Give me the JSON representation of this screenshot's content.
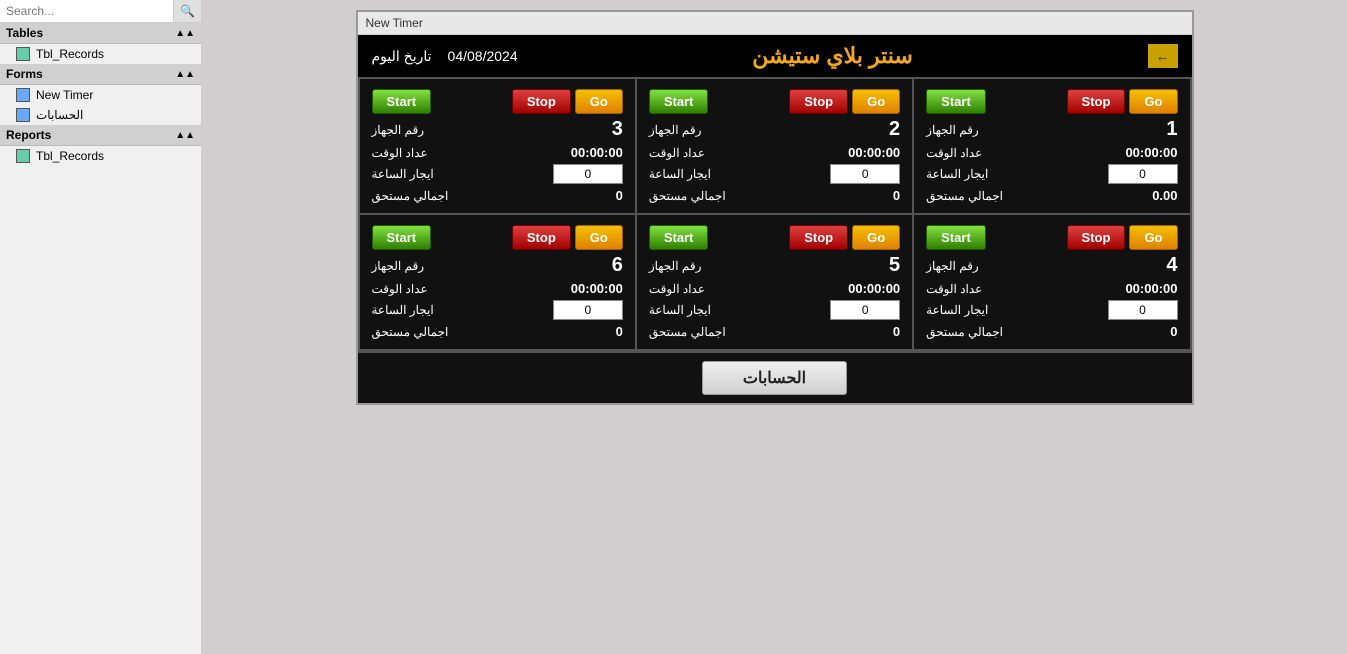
{
  "sidebar": {
    "search_placeholder": "Search...",
    "sections": [
      {
        "label": "Tables",
        "items": [
          {
            "label": "Tbl_Records",
            "type": "table"
          }
        ]
      },
      {
        "label": "Forms",
        "items": [
          {
            "label": "New Timer",
            "type": "form"
          },
          {
            "label": "الحسابات",
            "type": "form"
          }
        ]
      },
      {
        "label": "Reports",
        "items": [
          {
            "label": "Tbl_Records",
            "type": "table"
          }
        ]
      }
    ]
  },
  "window": {
    "title": "New Timer",
    "header": {
      "logo": "سنتر بلاي ستيشن",
      "date_label": "تاريخ اليوم",
      "date_value": "04/08/2024"
    },
    "timers": [
      {
        "id": 1,
        "number": "1",
        "device_label": "رقم الجهاز",
        "time_label": "عداد الوقت",
        "time_value": "00:00:00",
        "rent_label": "ايجار الساعة",
        "rent_value": "0",
        "total_label": "اجمالي مستحق",
        "total_value": "0.00"
      },
      {
        "id": 2,
        "number": "2",
        "device_label": "رقم الجهاز",
        "time_label": "عداد الوقت",
        "time_value": "00:00:00",
        "rent_label": "ايجار الساعة",
        "rent_value": "0",
        "total_label": "اجمالي مستحق",
        "total_value": "0"
      },
      {
        "id": 3,
        "number": "3",
        "device_label": "رقم الجهاز",
        "time_label": "عداد الوقت",
        "time_value": "00:00:00",
        "rent_label": "ايجار الساعة",
        "rent_value": "0",
        "total_label": "اجمالي مستحق",
        "total_value": "0"
      },
      {
        "id": 4,
        "number": "4",
        "device_label": "رقم الجهاز",
        "time_label": "عداد الوقت",
        "time_value": "00:00:00",
        "rent_label": "ايجار الساعة",
        "rent_value": "0",
        "total_label": "اجمالي مستحق",
        "total_value": "0"
      },
      {
        "id": 5,
        "number": "5",
        "device_label": "رقم الجهاز",
        "time_label": "عداد الوقت",
        "time_value": "00:00:00",
        "rent_label": "ايجار الساعة",
        "rent_value": "0",
        "total_label": "اجمالي مستحق",
        "total_value": "0"
      },
      {
        "id": 6,
        "number": "6",
        "device_label": "رقم الجهاز",
        "time_label": "عداد الوقت",
        "time_value": "00:00:00",
        "rent_label": "ايجار الساعة",
        "rent_value": "0",
        "total_label": "اجمالي مستحق",
        "total_value": "0"
      }
    ],
    "buttons": {
      "go": "Go",
      "stop": "Stop",
      "start": "Start",
      "footer": "الحسابات"
    }
  }
}
